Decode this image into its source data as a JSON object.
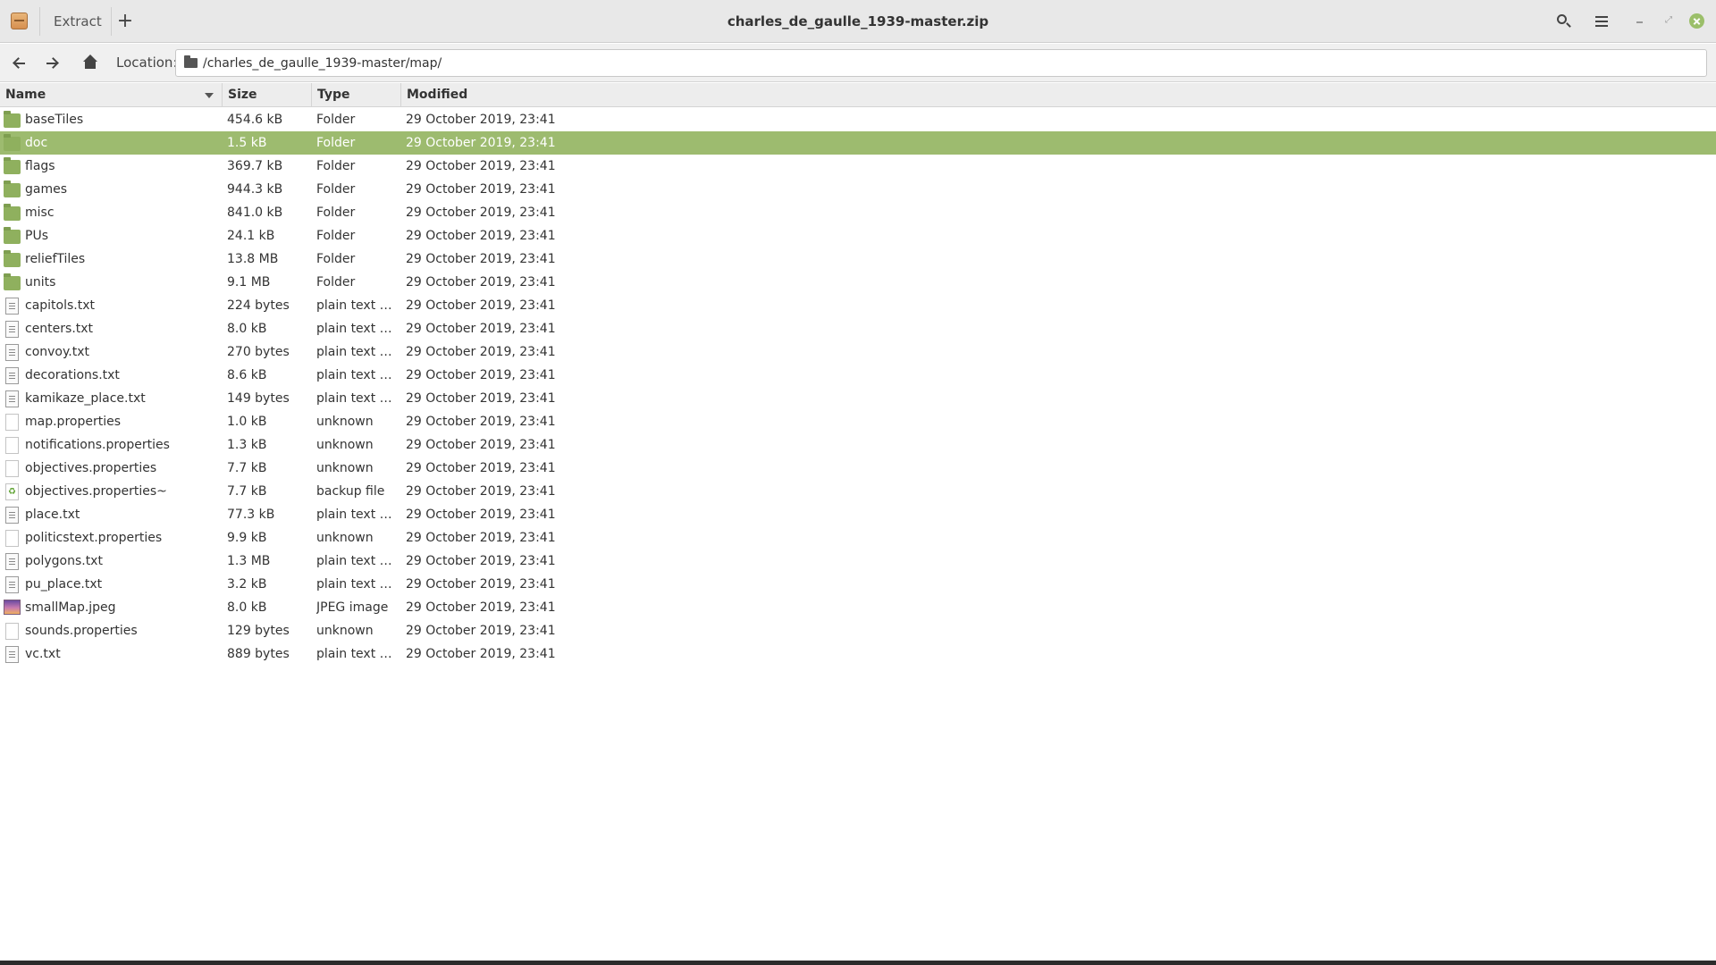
{
  "window": {
    "title": "charles_de_gaulle_1939-master.zip",
    "extract_label": "Extract",
    "new_label": "+"
  },
  "toolbar": {
    "location_label": "Location:",
    "location_value": "/charles_de_gaulle_1939-master/map/"
  },
  "columns": {
    "name": "Name",
    "size": "Size",
    "type": "Type",
    "modified": "Modified"
  },
  "icons": {
    "app": "archive-icon",
    "search": "search-icon",
    "menu": "hamburger-menu-icon",
    "back": "back-arrow-icon",
    "forward": "forward-arrow-icon",
    "home": "home-icon",
    "folder": "folder-icon",
    "text": "text-file-icon",
    "unknown": "unknown-file-icon",
    "backup": "backup-file-icon",
    "image": "image-file-icon"
  },
  "colors": {
    "selection": "#9dbb6f",
    "folder": "#8fb05e",
    "close_button": "#9bbf6a"
  },
  "files": [
    {
      "name": "baseTiles",
      "size": "454.6 kB",
      "type": "Folder",
      "modified": "29 October 2019, 23:41",
      "icon": "folder",
      "selected": false
    },
    {
      "name": "doc",
      "size": "1.5 kB",
      "type": "Folder",
      "modified": "29 October 2019, 23:41",
      "icon": "folder",
      "selected": true
    },
    {
      "name": "flags",
      "size": "369.7 kB",
      "type": "Folder",
      "modified": "29 October 2019, 23:41",
      "icon": "folder",
      "selected": false
    },
    {
      "name": "games",
      "size": "944.3 kB",
      "type": "Folder",
      "modified": "29 October 2019, 23:41",
      "icon": "folder",
      "selected": false
    },
    {
      "name": "misc",
      "size": "841.0 kB",
      "type": "Folder",
      "modified": "29 October 2019, 23:41",
      "icon": "folder",
      "selected": false
    },
    {
      "name": "PUs",
      "size": "24.1 kB",
      "type": "Folder",
      "modified": "29 October 2019, 23:41",
      "icon": "folder",
      "selected": false
    },
    {
      "name": "reliefTiles",
      "size": "13.8 MB",
      "type": "Folder",
      "modified": "29 October 2019, 23:41",
      "icon": "folder",
      "selected": false
    },
    {
      "name": "units",
      "size": "9.1 MB",
      "type": "Folder",
      "modified": "29 October 2019, 23:41",
      "icon": "folder",
      "selected": false
    },
    {
      "name": "capitols.txt",
      "size": "224 bytes",
      "type": "plain text do...",
      "modified": "29 October 2019, 23:41",
      "icon": "text",
      "selected": false
    },
    {
      "name": "centers.txt",
      "size": "8.0 kB",
      "type": "plain text do...",
      "modified": "29 October 2019, 23:41",
      "icon": "text",
      "selected": false
    },
    {
      "name": "convoy.txt",
      "size": "270 bytes",
      "type": "plain text do...",
      "modified": "29 October 2019, 23:41",
      "icon": "text",
      "selected": false
    },
    {
      "name": "decorations.txt",
      "size": "8.6 kB",
      "type": "plain text do...",
      "modified": "29 October 2019, 23:41",
      "icon": "text",
      "selected": false
    },
    {
      "name": "kamikaze_place.txt",
      "size": "149 bytes",
      "type": "plain text do...",
      "modified": "29 October 2019, 23:41",
      "icon": "text",
      "selected": false
    },
    {
      "name": "map.properties",
      "size": "1.0 kB",
      "type": "unknown",
      "modified": "29 October 2019, 23:41",
      "icon": "unknown",
      "selected": false
    },
    {
      "name": "notifications.properties",
      "size": "1.3 kB",
      "type": "unknown",
      "modified": "29 October 2019, 23:41",
      "icon": "unknown",
      "selected": false
    },
    {
      "name": "objectives.properties",
      "size": "7.7 kB",
      "type": "unknown",
      "modified": "29 October 2019, 23:41",
      "icon": "unknown",
      "selected": false
    },
    {
      "name": "objectives.properties~",
      "size": "7.7 kB",
      "type": "backup file",
      "modified": "29 October 2019, 23:41",
      "icon": "backup",
      "selected": false
    },
    {
      "name": "place.txt",
      "size": "77.3 kB",
      "type": "plain text do...",
      "modified": "29 October 2019, 23:41",
      "icon": "text",
      "selected": false
    },
    {
      "name": "politicstext.properties",
      "size": "9.9 kB",
      "type": "unknown",
      "modified": "29 October 2019, 23:41",
      "icon": "unknown",
      "selected": false
    },
    {
      "name": "polygons.txt",
      "size": "1.3 MB",
      "type": "plain text do...",
      "modified": "29 October 2019, 23:41",
      "icon": "text",
      "selected": false
    },
    {
      "name": "pu_place.txt",
      "size": "3.2 kB",
      "type": "plain text do...",
      "modified": "29 October 2019, 23:41",
      "icon": "text",
      "selected": false
    },
    {
      "name": "smallMap.jpeg",
      "size": "8.0 kB",
      "type": "JPEG image",
      "modified": "29 October 2019, 23:41",
      "icon": "image",
      "selected": false
    },
    {
      "name": "sounds.properties",
      "size": "129 bytes",
      "type": "unknown",
      "modified": "29 October 2019, 23:41",
      "icon": "unknown",
      "selected": false
    },
    {
      "name": "vc.txt",
      "size": "889 bytes",
      "type": "plain text do...",
      "modified": "29 October 2019, 23:41",
      "icon": "text",
      "selected": false
    }
  ]
}
